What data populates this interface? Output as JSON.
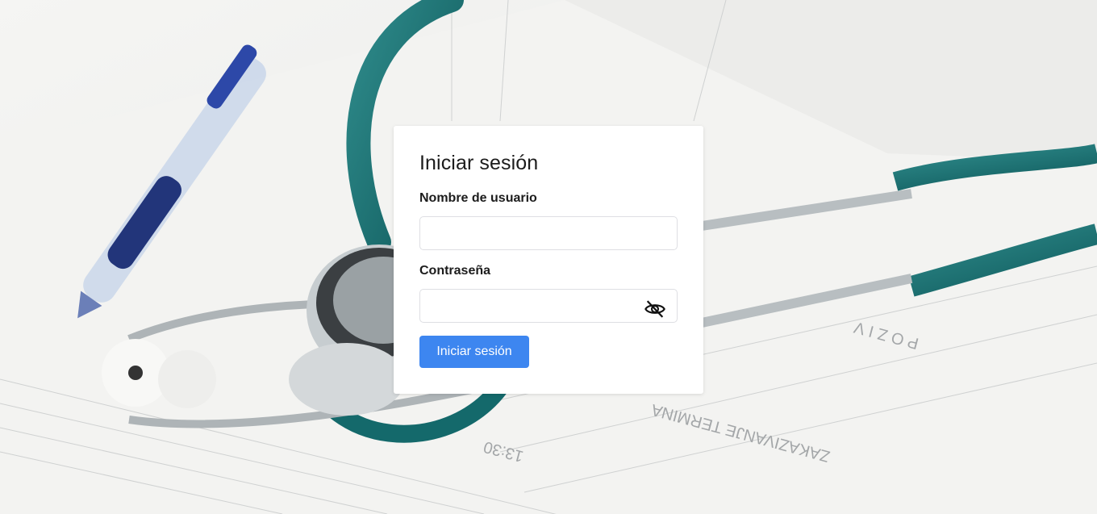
{
  "background": {
    "image": "stethoscope-and-pen-on-medical-form"
  },
  "login": {
    "title": "Iniciar sesión",
    "username_label": "Nombre de usuario",
    "username_value": "",
    "password_label": "Contraseña",
    "password_value": "",
    "toggle_icon": "eye-slash-icon",
    "submit_label": "Iniciar sesión",
    "accent_color": "#3d86f0"
  }
}
